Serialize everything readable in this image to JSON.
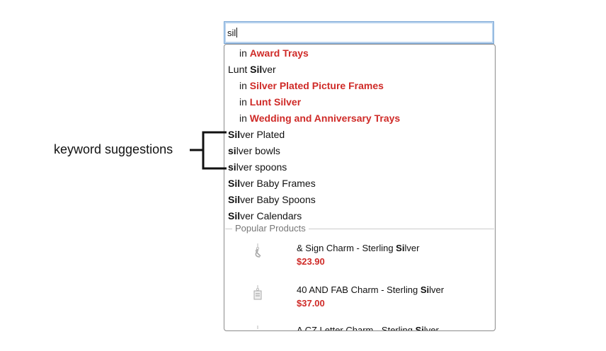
{
  "search": {
    "value": "sil"
  },
  "suggestions": {
    "rows": [
      {
        "type": "category",
        "prefix": "in",
        "label": "Award Trays"
      },
      {
        "type": "keyword",
        "bold": "Sil",
        "rest": "ver",
        "pre": "Lunt "
      },
      {
        "type": "category",
        "prefix": "in",
        "label": "Silver Plated Picture Frames"
      },
      {
        "type": "category",
        "prefix": "in",
        "label": "Lunt Silver"
      },
      {
        "type": "category",
        "prefix": "in",
        "label": "Wedding and Anniversary Trays"
      },
      {
        "type": "keyword",
        "pre": "",
        "bold": "Sil",
        "rest": "ver Plated"
      },
      {
        "type": "keyword",
        "pre": "",
        "bold": "si",
        "rest": "lver bowls"
      },
      {
        "type": "keyword",
        "pre": "",
        "bold": "si",
        "rest": "lver spoons"
      },
      {
        "type": "keyword",
        "pre": "",
        "bold": "Sil",
        "rest": "ver Baby Frames"
      },
      {
        "type": "keyword",
        "pre": "",
        "bold": "Sil",
        "rest": "ver Baby Spoons"
      },
      {
        "type": "keyword",
        "pre": "",
        "bold": "Sil",
        "rest": "ver Calendars"
      }
    ]
  },
  "popular": {
    "heading": "Popular Products",
    "products": [
      {
        "name_pre": "& Sign Charm - Sterling ",
        "name_bold": "Si",
        "name_rest": "lver",
        "price": "$23.90",
        "icon": "charm-ampersand-icon"
      },
      {
        "name_pre": "40 AND FAB Charm - Sterling ",
        "name_bold": "Si",
        "name_rest": "lver",
        "price": "$37.00",
        "icon": "charm-tag-icon"
      },
      {
        "name_pre": "A CZ Letter Charm - Sterling ",
        "name_bold": "Si",
        "name_rest": "lver",
        "price": "",
        "icon": "charm-letter-icon"
      }
    ]
  },
  "annotation": {
    "label": "keyword suggestions"
  }
}
